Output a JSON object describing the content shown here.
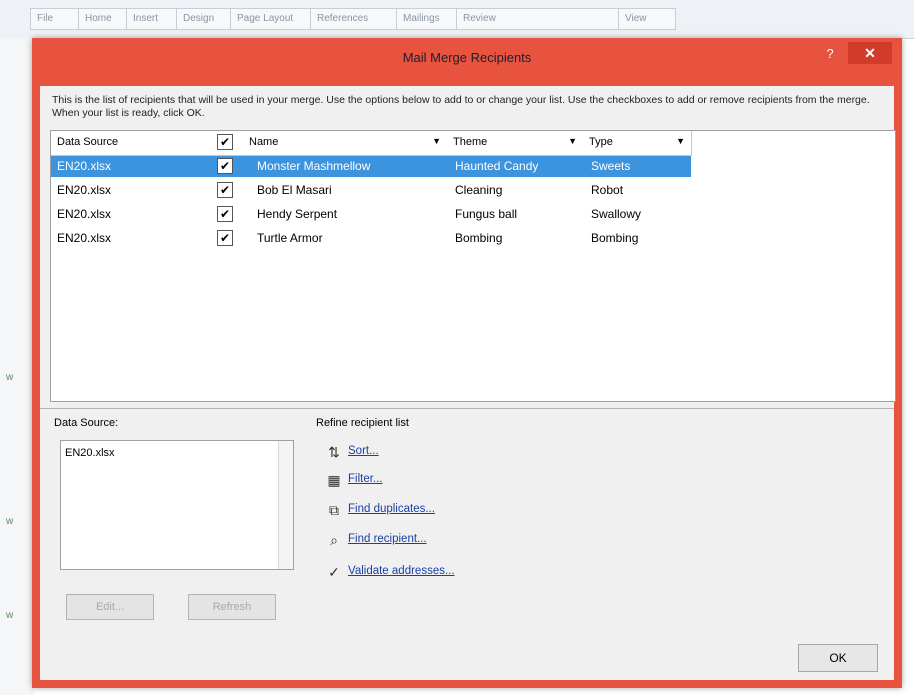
{
  "background": {
    "tabs": [
      "File",
      "Home",
      "Insert",
      "Design",
      "Page Layout",
      "References",
      "Mailings",
      "Review",
      "View"
    ],
    "side_marks": [
      "w",
      "w",
      "w"
    ]
  },
  "dialog": {
    "title": "Mail Merge Recipients",
    "help_label": "?",
    "close_label": "✕",
    "instructions": "This is the list of recipients that will be used in your merge. Use the options below to add to or change your list. Use the checkboxes to add or remove recipients from the merge. When your list is ready, click OK.",
    "columns": {
      "data_source": "Data Source",
      "name": "Name",
      "theme": "Theme",
      "type": "Type"
    },
    "rows": [
      {
        "source": "EN20.xlsx",
        "checked": "✔",
        "name": "Monster Mashmellow",
        "theme": "Haunted Candy",
        "type": "Sweets"
      },
      {
        "source": "EN20.xlsx",
        "checked": "✔",
        "name": "Bob El Masari",
        "theme": "Cleaning",
        "type": "Robot"
      },
      {
        "source": "EN20.xlsx",
        "checked": "✔",
        "name": "Hendy Serpent",
        "theme": "Fungus ball",
        "type": "Swallowy"
      },
      {
        "source": "EN20.xlsx",
        "checked": "✔",
        "name": "Turtle Armor",
        "theme": "Bombing",
        "type": "Bombing"
      }
    ],
    "data_source_label": "Data Source:",
    "data_source_item": "EN20.xlsx",
    "edit_button": "Edit...",
    "refresh_button": "Refresh",
    "refine_label": "Refine recipient list",
    "links": [
      {
        "icon": "⇅",
        "label": "Sort..."
      },
      {
        "icon": "▦",
        "label": "Filter..."
      },
      {
        "icon": "⧉",
        "label": "Find duplicates..."
      },
      {
        "icon": "⌕",
        "label": "Find recipient..."
      },
      {
        "icon": "✓",
        "label": "Validate addresses..."
      }
    ],
    "ok_button": "OK"
  }
}
